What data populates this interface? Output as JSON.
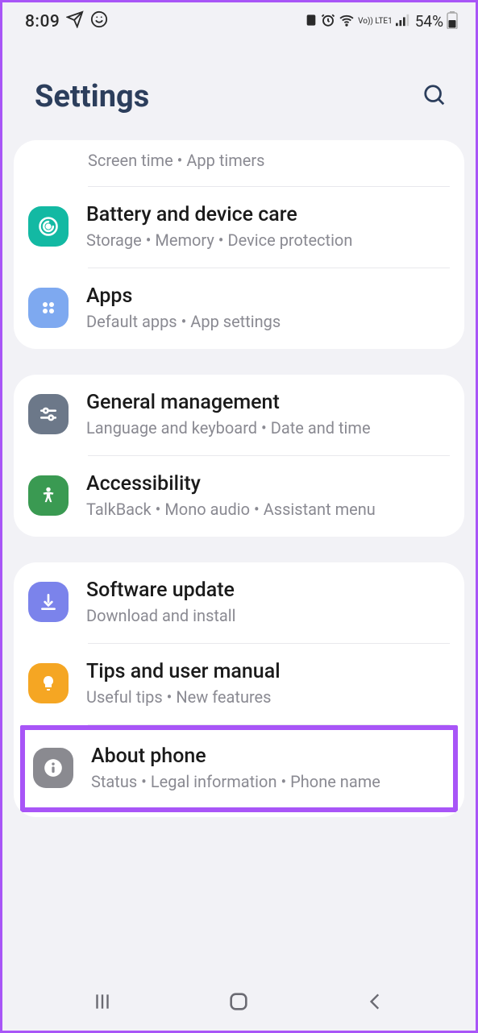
{
  "status": {
    "time": "8:09",
    "battery": "54%",
    "lte": "Vo)) LTE1"
  },
  "header": {
    "title": "Settings"
  },
  "groups": [
    {
      "items": [
        {
          "title": "",
          "sub": "Screen time  •  App timers"
        },
        {
          "title": "Battery and device care",
          "sub": "Storage  •  Memory  •  Device protection"
        },
        {
          "title": "Apps",
          "sub": "Default apps  •  App settings"
        }
      ]
    },
    {
      "items": [
        {
          "title": "General management",
          "sub": "Language and keyboard  •  Date and time"
        },
        {
          "title": "Accessibility",
          "sub": "TalkBack  •  Mono audio  •  Assistant menu"
        }
      ]
    },
    {
      "items": [
        {
          "title": "Software update",
          "sub": "Download and install"
        },
        {
          "title": "Tips and user manual",
          "sub": "Useful tips  •  New features"
        },
        {
          "title": "About phone",
          "sub": "Status  •  Legal information  •  Phone name"
        }
      ]
    }
  ]
}
